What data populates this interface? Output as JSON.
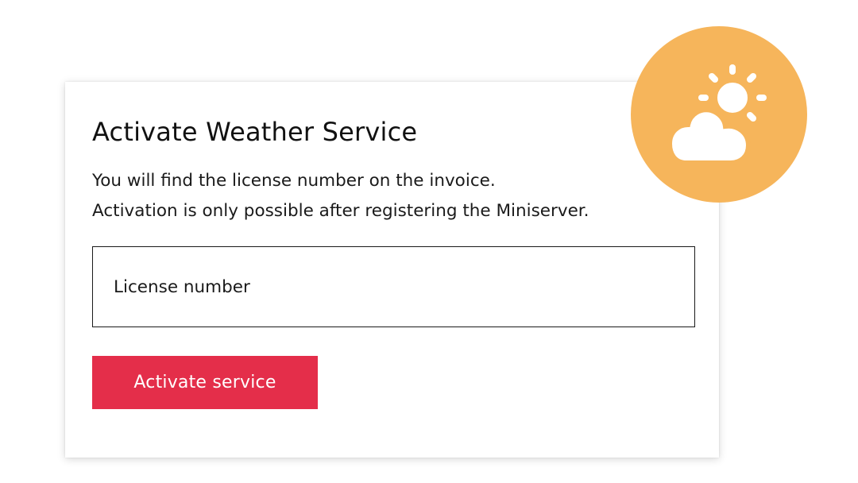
{
  "dialog": {
    "title": "Activate Weather Service",
    "description_line1": "You will find the license number on the invoice.",
    "description_line2": "Activation is only possible after registering the Miniserver.",
    "license_input": {
      "placeholder": "License number",
      "value": ""
    },
    "activate_button_label": "Activate service"
  },
  "badge": {
    "icon": "partly-sunny-icon"
  },
  "colors": {
    "accent_button": "#e42e4a",
    "badge_background": "#f6b55b",
    "icon_color": "#ffffff",
    "text": "#111111"
  }
}
